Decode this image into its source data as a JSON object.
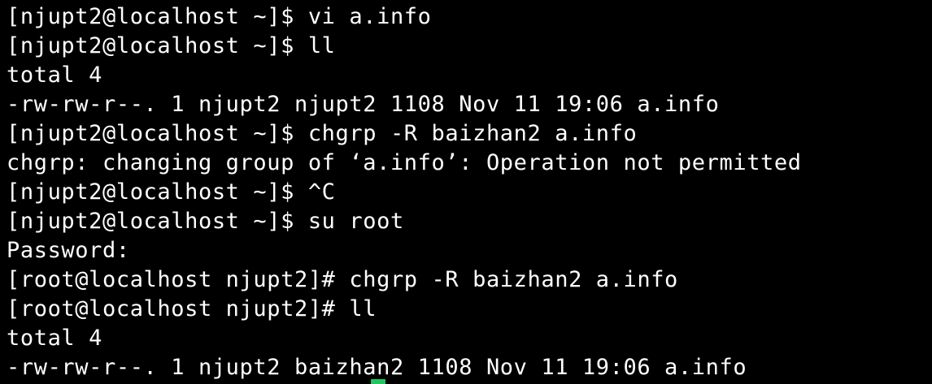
{
  "terminal": {
    "lines": [
      "[njupt2@localhost ~]$ vi a.info",
      "[njupt2@localhost ~]$ ll",
      "total 4",
      "-rw-rw-r--. 1 njupt2 njupt2 1108 Nov 11 19:06 a.info",
      "[njupt2@localhost ~]$ chgrp -R baizhan2 a.info",
      "chgrp: changing group of ‘a.info’: Operation not permitted",
      "[njupt2@localhost ~]$ ^C",
      "[njupt2@localhost ~]$ su root",
      "Password:",
      "[root@localhost njupt2]# chgrp -R baizhan2 a.info",
      "[root@localhost njupt2]# ll",
      "total 4",
      "-rw-rw-r--. 1 njupt2 baizhan2 1108 Nov 11 19:06 a.info"
    ],
    "colors": {
      "background": "#000000",
      "text": "#ffffff",
      "cursor": "#22c55e"
    }
  }
}
